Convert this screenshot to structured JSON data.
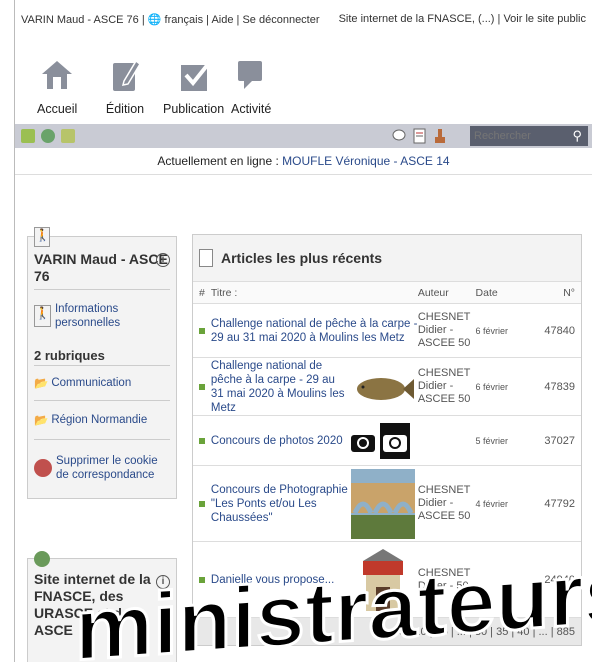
{
  "topbar": {
    "user": "VARIN Maud - ASCE 76",
    "language": "français",
    "help": "Aide",
    "logout": "Se déconnecter",
    "site": "Site internet de la FNASCE, (...)",
    "public": "Voir le site public"
  },
  "toolbar": {
    "home": "Accueil",
    "edit": "Édition",
    "publish": "Publication",
    "activity": "Activité"
  },
  "search": {
    "placeholder": "Rechercher"
  },
  "online": {
    "label": "Actuellement en ligne :",
    "who": "MOUFLE Véronique - ASCE 14"
  },
  "left": {
    "title": "VARIN Maud - ASCE 76",
    "info": "Informations personnelles",
    "rubriques": "2 rubriques",
    "items": [
      "Communication",
      "Région Normandie"
    ],
    "cookie": "Supprimer le cookie de correspondance",
    "title2": "Site internet de la FNASCE, des URASCE et des ASCE"
  },
  "articles": {
    "title": "Articles les plus récents",
    "cols": [
      "#",
      "Titre :",
      "Auteur",
      "Date",
      "N°"
    ],
    "rows": [
      {
        "title": "Challenge national de pêche à la carpe - 29 au 31 mai 2020 à Moulins les Metz",
        "author": "CHESNET Didier - ASCEE 50",
        "date": "6 février",
        "num": "47840",
        "image": ""
      },
      {
        "title": "Challenge national de pêche à la carpe - 29 au 31 mai 2020 à Moulins les Metz",
        "author": "CHESNET Didier - ASCEE 50",
        "date": "6 février",
        "num": "47839",
        "image": "fish"
      },
      {
        "title": "Concours de photos 2020",
        "author": "",
        "date": "5 février",
        "num": "37027",
        "image": "cameras"
      },
      {
        "title": "Concours de Photographie \"Les Ponts et/ou Les Chaussées\"",
        "author": "CHESNET Didier - ASCEE 50",
        "date": "4 février",
        "num": "47792",
        "image": "bridge"
      },
      {
        "title": "Danielle vous propose...",
        "author": "CHESNET Didier - 50",
        "date": "",
        "num": "24940",
        "image": "shop"
      }
    ],
    "pager": "5 | 10 | 15 | ... | 30 | 35 | 40 | ... | 885"
  },
  "overlay_text": "ministrateurs"
}
